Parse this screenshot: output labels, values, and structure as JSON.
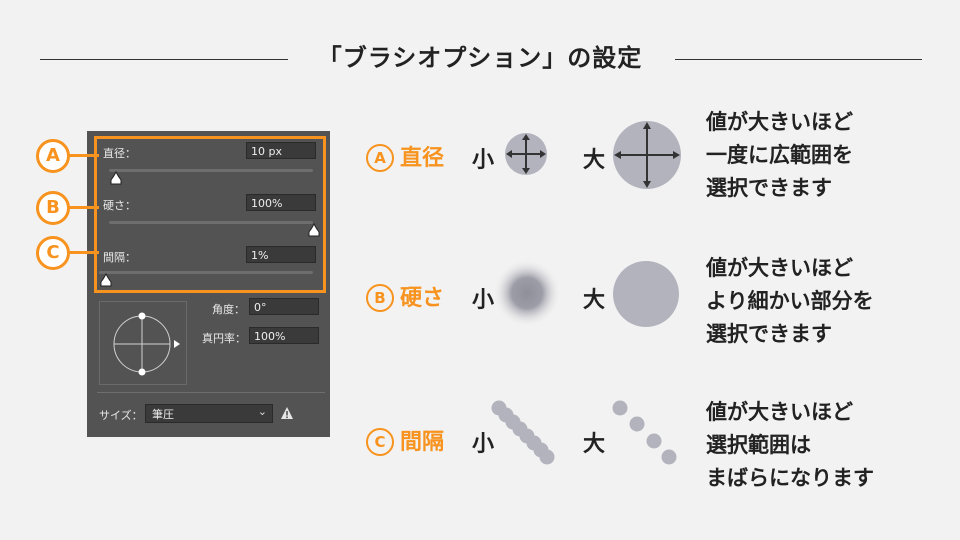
{
  "heading": "「ブラシオプション」の設定",
  "panel": {
    "diameter_label": "直径：",
    "diameter_value": "10 px",
    "hardness_label": "硬さ：",
    "hardness_value": "100%",
    "spacing_label": "間隔：",
    "spacing_value": "1%",
    "angle_label": "角度：",
    "angle_value": "0°",
    "roundness_label": "真円率：",
    "roundness_value": "100%",
    "size_label": "サイズ：",
    "size_select_value": "筆圧",
    "diameter_slider_level": 0.05,
    "hardness_slider_level": 1.0,
    "spacing_slider_level": 0.0
  },
  "callouts": [
    "A",
    "B",
    "C"
  ],
  "rows": [
    {
      "letter": "A",
      "name": "直径",
      "small": "小",
      "large": "大",
      "desc": [
        "値が大きいほど",
        "一度に広範囲を",
        "選択できます"
      ]
    },
    {
      "letter": "B",
      "name": "硬さ",
      "small": "小",
      "large": "大",
      "desc": [
        "値が大きいほど",
        "より細かい部分を",
        "選択できます"
      ]
    },
    {
      "letter": "C",
      "name": "間隔",
      "small": "小",
      "large": "大",
      "desc": [
        "値が大きいほど",
        "選択範囲は",
        "まばらになります"
      ]
    }
  ],
  "colors": {
    "accent": "#f7931e",
    "panel": "#535353",
    "sample": "#b3b3be"
  }
}
